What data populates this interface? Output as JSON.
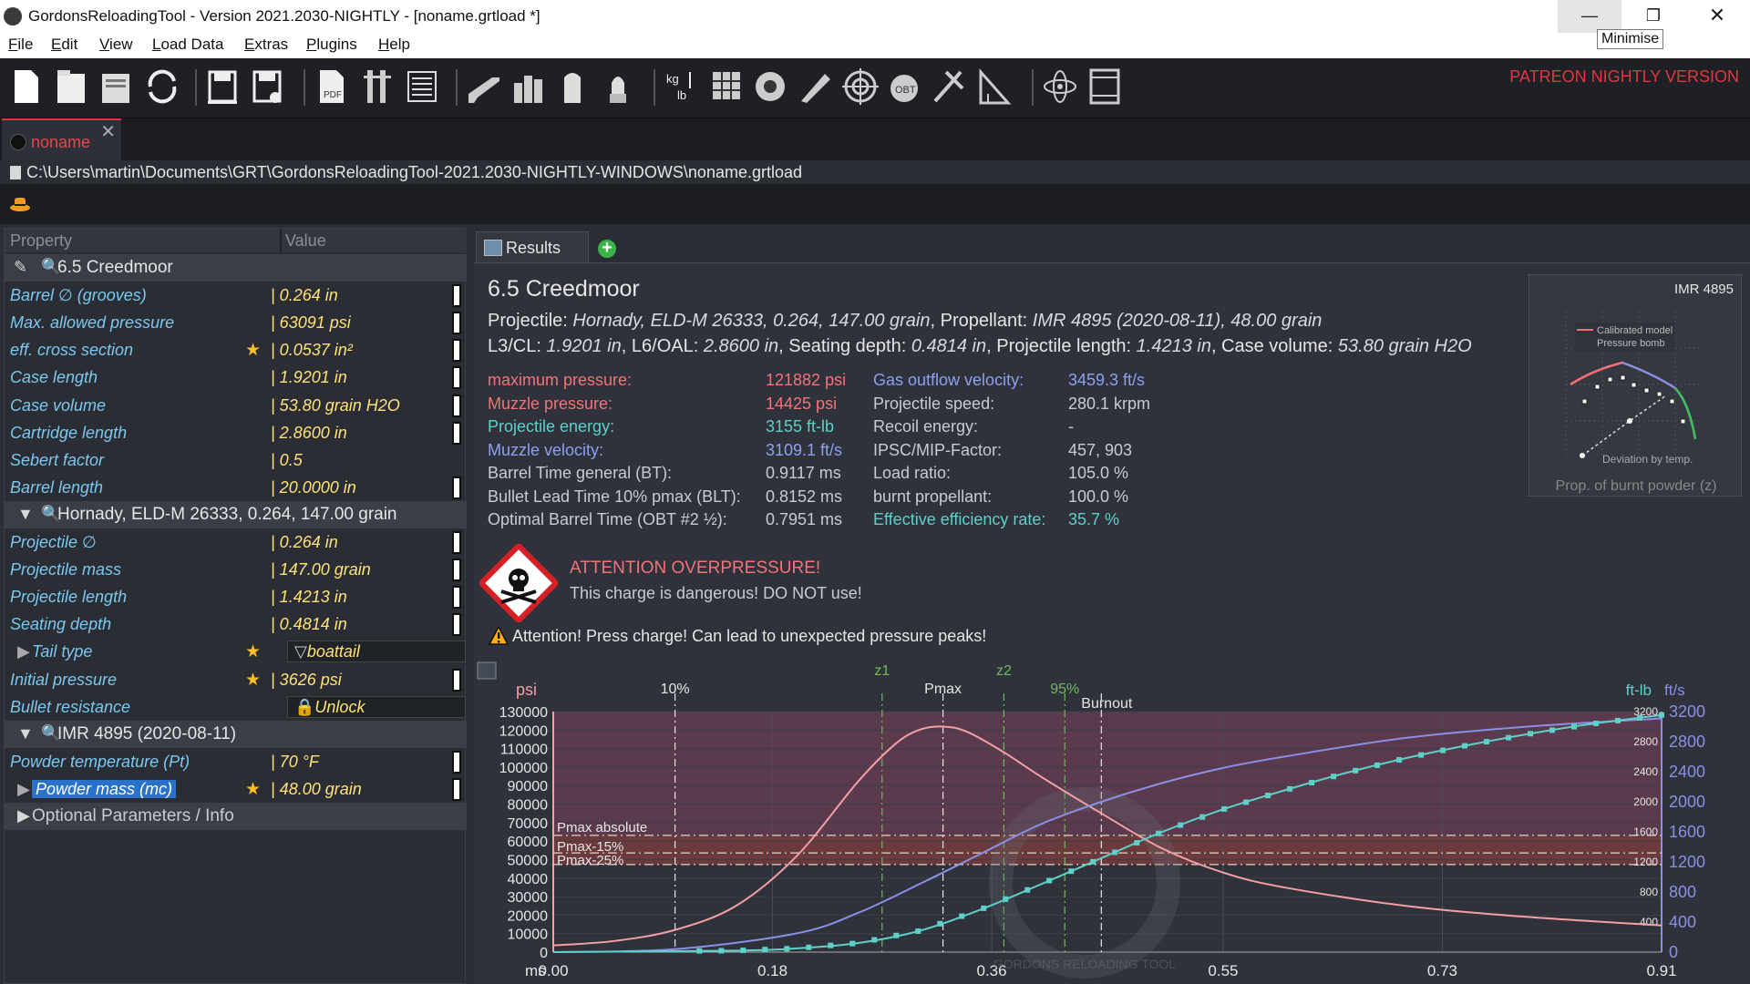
{
  "window": {
    "title": "GordonsReloadingTool - Version 2021.2030-NIGHTLY - [noname.grtload *]",
    "tooltip": "Minimise",
    "min_glyph": "—",
    "max_glyph": "❐",
    "close_glyph": "✕"
  },
  "menu": [
    {
      "ul": "F",
      "rest": "ile"
    },
    {
      "ul": "E",
      "rest": "dit"
    },
    {
      "ul": "V",
      "rest": "iew"
    },
    {
      "ul": "L",
      "rest": "oad Data"
    },
    {
      "ul": "E",
      "rest": "xtras"
    },
    {
      "ul": "P",
      "rest": "lugins"
    },
    {
      "ul": "H",
      "rest": "elp"
    }
  ],
  "toolbar": {
    "patreon": "PATREON NIGHTLY VERSION",
    "icons": [
      "new-file-icon",
      "open-file-icon",
      "open-recent-icon",
      "reload-icon",
      "save-icon",
      "save-as-icon",
      "pdf-export-icon",
      "cartridge-measure-icon",
      "report-icon",
      "rifle-icon",
      "powder-bottles-icon",
      "cartridge-case-icon",
      "bullet-icon",
      "unit-conversion-icon",
      "grid-icon",
      "barrel-icon",
      "measure-icon",
      "target-icon",
      "obt-icon",
      "tools-icon",
      "ruler-triangle-icon",
      "atom-icon",
      "film-icon"
    ]
  },
  "doc_tab": {
    "label": "noname",
    "close": "✕"
  },
  "path": "C:\\Users\\martin\\Documents\\GRT\\GordonsReloadingTool-2021.2030-NIGHTLY-WINDOWS\\noname.grtload",
  "property_panel": {
    "col_property": "Property",
    "col_value": "Value",
    "cartridge_group": "6.5 Creedmoor",
    "cartridge_rows": [
      {
        "name": "Barrel ∅ (grooves)",
        "value": "| 0.264 in"
      },
      {
        "name": "Max. allowed pressure",
        "value": "| 63091 psi"
      },
      {
        "name": "eff. cross section",
        "value": "| 0.0537 in²"
      },
      {
        "name": "Case length",
        "value": "| 1.9201 in"
      },
      {
        "name": "Case volume",
        "value": "| 53.80 grain H2O"
      },
      {
        "name": "Cartridge length",
        "value": "| 2.8600 in"
      },
      {
        "name": "Sebert factor",
        "value": "| 0.5"
      },
      {
        "name": "Barrel length",
        "value": "| 20.0000 in"
      }
    ],
    "projectile_group": "Hornady, ELD-M 26333, 0.264, 147.00 grain",
    "projectile_rows": [
      {
        "name": "Projectile ∅",
        "value": "| 0.264 in"
      },
      {
        "name": "Projectile mass",
        "value": "| 147.00 grain"
      },
      {
        "name": "Projectile length",
        "value": "| 1.4213 in"
      },
      {
        "name": "Seating depth",
        "value": "| 0.4814 in"
      },
      {
        "name": "Tail type",
        "value": "boattail"
      },
      {
        "name": "Initial pressure",
        "value": "| 3626 psi"
      },
      {
        "name": "Bullet resistance",
        "value": "Unlock"
      }
    ],
    "powder_group": "IMR 4895 (2020-08-11)",
    "powder_rows": [
      {
        "name": "Powder temperature (Pt)",
        "value": "| 70 °F"
      },
      {
        "name": "Powder mass (mc)",
        "value": "| 48.00 grain"
      }
    ],
    "optional": "Optional Parameters / Info"
  },
  "results": {
    "tab": "Results",
    "add_tab": "+",
    "title": "6.5 Creedmoor",
    "line1": {
      "l1": "Projectile: ",
      "v1": "Hornady, ELD-M 26333, 0.264, 147.00 grain",
      "l2": ", Propellant: ",
      "v2": "IMR 4895 (2020-08-11), 48.00 grain"
    },
    "line2": {
      "l1": "L3/CL: ",
      "v1": "1.9201 in",
      "l2": ", L6/OAL: ",
      "v2": "2.8600 in",
      "l3": ", Seating depth: ",
      "v3": "0.4814 in",
      "l4": ", Projectile length: ",
      "v4": "1.4213 in",
      "l5": ", Case volume: ",
      "v5": "53.80 grain H2O"
    },
    "col_a": [
      {
        "label": "maximum pressure:",
        "value": "121882 psi",
        "color": "red"
      },
      {
        "label": "Muzzle pressure:",
        "value": "14425 psi",
        "color": "red"
      },
      {
        "label": "Projectile energy:",
        "value": "3155 ft-lb",
        "color": "cyan"
      },
      {
        "label": "Muzzle velocity:",
        "value": "3109.1 ft/s",
        "color": "blue"
      },
      {
        "label": "Barrel Time general (BT):",
        "value": "0.9117 ms",
        "color": "gray"
      },
      {
        "label": "Bullet Lead Time 10% pmax (BLT):",
        "value": "0.8152 ms",
        "color": "gray"
      },
      {
        "label": "Optimal Barrel Time (OBT #2 ½):",
        "value": "0.7951 ms",
        "color": "gray"
      }
    ],
    "col_b": [
      {
        "label": "Gas outflow velocity:",
        "value": "3459.3 ft/s",
        "color": "blue"
      },
      {
        "label": "Projectile speed:",
        "value": "280.1 krpm",
        "color": "gray"
      },
      {
        "label": "Recoil energy:",
        "value": "-",
        "color": "gray"
      },
      {
        "label": "IPSC/MIP-Factor:",
        "value": "457, 903",
        "color": "gray"
      },
      {
        "label": "Load ratio:",
        "value": "105.0 %",
        "color": "gray"
      },
      {
        "label": "burnt propellant:",
        "value": "100.0 %",
        "color": "gray"
      },
      {
        "label": "Effective efficiency rate:",
        "value": "35.7 %",
        "color": "cyan"
      }
    ],
    "attention_title": "ATTENTION OVERPRESSURE!",
    "attention_sub": "This charge is dangerous! DO NOT use!",
    "press_warning": "Attention! Press charge! Can lead to unexpected pressure peaks!",
    "thumb_title": "IMR 4895",
    "thumb_xlabel": "Prop. of burnt powder (z)",
    "thumb_legend1": "Calibrated model",
    "thumb_legend2": "Pressure bomb",
    "thumb_legend3": "Deviation by temp."
  },
  "chart_data": {
    "type": "line",
    "xlabel": "ms",
    "x_ticks": [
      "0.00",
      "0.18",
      "0.36",
      "0.55",
      "0.73",
      "0.91"
    ],
    "xlim": [
      0.0,
      0.91
    ],
    "ylabel_left": "psi",
    "y_left_ticks": [
      "130000",
      "120000",
      "110000",
      "100000",
      "90000",
      "80000",
      "70000",
      "60000",
      "50000",
      "40000",
      "30000",
      "20000",
      "10000",
      "0"
    ],
    "ylim_left": [
      0,
      130000
    ],
    "ylabel_right1": "ft-lb",
    "y_right1_ticks": [
      "3200",
      "2800",
      "2400",
      "2000",
      "1600",
      "1200",
      "800",
      "400"
    ],
    "ylabel_right2": "ft/s",
    "y_right2_ticks": [
      "3200",
      "2800",
      "2400",
      "2000",
      "1600",
      "1200",
      "800",
      "400",
      "0"
    ],
    "ylim_right": [
      0,
      3200
    ],
    "markers": [
      {
        "label": "10%",
        "x": 0.1
      },
      {
        "label": "z1",
        "x": 0.27
      },
      {
        "label": "Pmax",
        "x": 0.32
      },
      {
        "label": "z2",
        "x": 0.37
      },
      {
        "label": "95%",
        "x": 0.42
      },
      {
        "label": "Burnout",
        "x": 0.45
      }
    ],
    "hlines": [
      {
        "label": "Pmax absolute",
        "y": 63091
      },
      {
        "label": "Pmax-15%",
        "y": 53627
      },
      {
        "label": "Pmax-25%",
        "y": 47318
      }
    ],
    "series": [
      {
        "name": "pressure",
        "axis": "left",
        "color": "#f3a0a6",
        "x": [
          0.0,
          0.05,
          0.1,
          0.15,
          0.2,
          0.25,
          0.28,
          0.3,
          0.32,
          0.34,
          0.37,
          0.4,
          0.45,
          0.5,
          0.55,
          0.6,
          0.7,
          0.8,
          0.91
        ],
        "y": [
          3626,
          6000,
          12000,
          25000,
          52000,
          92000,
          112000,
          120000,
          121882,
          119000,
          108000,
          95000,
          75000,
          56000,
          43000,
          35000,
          25000,
          19000,
          14425
        ]
      },
      {
        "name": "velocity",
        "axis": "right",
        "color": "#8b90e6",
        "x": [
          0.0,
          0.1,
          0.2,
          0.25,
          0.3,
          0.35,
          0.4,
          0.45,
          0.5,
          0.55,
          0.6,
          0.7,
          0.8,
          0.91
        ],
        "y": [
          0,
          40,
          250,
          520,
          900,
          1300,
          1700,
          2000,
          2250,
          2450,
          2600,
          2850,
          3000,
          3109
        ]
      },
      {
        "name": "energy",
        "axis": "right",
        "color": "#5fd0c8",
        "x": [
          0.0,
          0.15,
          0.2,
          0.25,
          0.3,
          0.35,
          0.4,
          0.45,
          0.5,
          0.55,
          0.6,
          0.65,
          0.7,
          0.75,
          0.8,
          0.85,
          0.91
        ],
        "y": [
          0,
          20,
          50,
          120,
          280,
          560,
          900,
          1250,
          1600,
          1900,
          2150,
          2380,
          2580,
          2750,
          2900,
          3030,
          3155
        ]
      }
    ],
    "watermark": "GORDONS RELOADING TOOL"
  }
}
